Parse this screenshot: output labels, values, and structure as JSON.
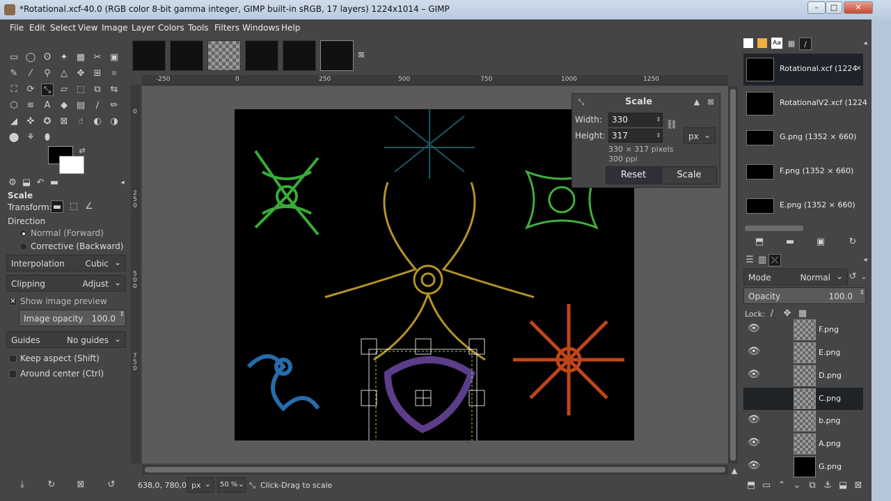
{
  "window": {
    "title": "*Rotational.xcf-40.0 (RGB color 8-bit gamma integer, GIMP built-in sRGB, 17 layers) 1224x1014 – GIMP",
    "minimize": "–",
    "maximize": "□",
    "close": "✕"
  },
  "menu": [
    "File",
    "Edit",
    "Select",
    "View",
    "Image",
    "Layer",
    "Colors",
    "Tools",
    "Filters",
    "Windows",
    "Help"
  ],
  "tool_options": {
    "title": "Scale",
    "transform_label": "Transform:",
    "direction_label": "Direction",
    "direction_normal": "Normal (Forward)",
    "direction_corrective": "Corrective (Backward)",
    "interpolation_label": "Interpolation",
    "interpolation_value": "Cubic",
    "clipping_label": "Clipping",
    "clipping_value": "Adjust",
    "show_preview": "Show image preview",
    "image_opacity_label": "Image opacity",
    "image_opacity_value": "100.0",
    "guides_label": "Guides",
    "guides_value": "No guides",
    "keep_aspect": "Keep aspect (Shift)",
    "around_center": "Around center (Ctrl)"
  },
  "ruler": {
    "h_ticks": [
      "-250",
      "0",
      "250",
      "500",
      "750",
      "1000",
      "1250"
    ],
    "v_ticks": [
      "0",
      "2 5 0",
      "5 0 0",
      "7 5 0"
    ]
  },
  "scale_dialog": {
    "title": "Scale",
    "width_label": "Width:",
    "width_value": "330",
    "height_label": "Height:",
    "height_value": "317",
    "pixels_info": "330 × 317 pixels",
    "ppi_info": "300 ppi",
    "unit": "px",
    "reset_label": "Reset",
    "scale_label": "Scale"
  },
  "status": {
    "coords": "638,0, 780,0",
    "unit": "px",
    "zoom": "50 %",
    "message": "Click-Drag to scale"
  },
  "images_panel": [
    {
      "name": "Rotational.xcf (1224",
      "selected": true
    },
    {
      "name": "RotationalV2.xcf (1224",
      "selected": false
    },
    {
      "name": "G.png (1352 × 660)",
      "selected": false
    },
    {
      "name": "F.png (1352 × 660)",
      "selected": false
    },
    {
      "name": "E.png (1352 × 660)",
      "selected": false
    }
  ],
  "layers_panel": {
    "mode_label": "Mode",
    "mode_value": "Normal",
    "opacity_label": "Opacity",
    "opacity_value": "100.0",
    "lock_label": "Lock:",
    "layers": [
      {
        "name": "F.png",
        "visible": true,
        "selected": false
      },
      {
        "name": "E.png",
        "visible": true,
        "selected": false
      },
      {
        "name": "D.png",
        "visible": true,
        "selected": false
      },
      {
        "name": "C.png",
        "visible": false,
        "selected": true
      },
      {
        "name": "b.png",
        "visible": true,
        "selected": false
      },
      {
        "name": "A.png",
        "visible": true,
        "selected": false
      },
      {
        "name": "G.png",
        "visible": true,
        "selected": false
      }
    ]
  },
  "colors": {
    "accent": "#2b2b2b",
    "panel": "#454545",
    "canvas_bg": "#5b5b5b",
    "artwork_bg": "#000000"
  }
}
